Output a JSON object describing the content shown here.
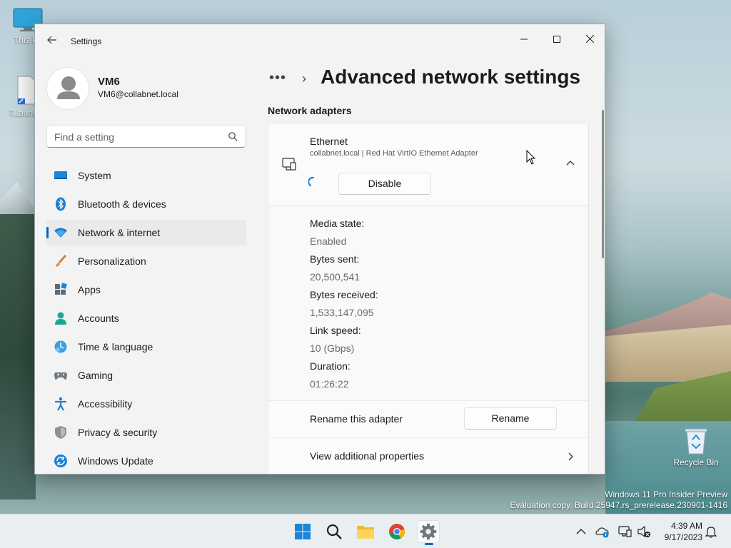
{
  "desktop": {
    "icons": [
      {
        "label": "This PC"
      },
      {
        "label": "TLauncher"
      },
      {
        "label": "Recycle Bin"
      }
    ],
    "watermark": {
      "line1": "Windows 11 Pro Insider Preview",
      "line2": "Evaluation copy. Build 25947.rs_prerelease.230901-1416"
    }
  },
  "window": {
    "title": "Settings",
    "controls": {
      "minimize": "minimize-icon",
      "maximize": "maximize-icon",
      "close": "close-icon"
    }
  },
  "profile": {
    "name": "VM6",
    "email": "VM6@collabnet.local"
  },
  "search": {
    "placeholder": "Find a setting",
    "value": ""
  },
  "sidebar": {
    "items": [
      {
        "label": "System",
        "icon": "system-icon",
        "selected": false
      },
      {
        "label": "Bluetooth & devices",
        "icon": "bluetooth-icon",
        "selected": false
      },
      {
        "label": "Network & internet",
        "icon": "network-icon",
        "selected": true
      },
      {
        "label": "Personalization",
        "icon": "brush-icon",
        "selected": false
      },
      {
        "label": "Apps",
        "icon": "apps-icon",
        "selected": false
      },
      {
        "label": "Accounts",
        "icon": "accounts-icon",
        "selected": false
      },
      {
        "label": "Time & language",
        "icon": "time-language-icon",
        "selected": false
      },
      {
        "label": "Gaming",
        "icon": "gaming-icon",
        "selected": false
      },
      {
        "label": "Accessibility",
        "icon": "accessibility-icon",
        "selected": false
      },
      {
        "label": "Privacy & security",
        "icon": "shield-icon",
        "selected": false
      },
      {
        "label": "Windows Update",
        "icon": "update-icon",
        "selected": false
      }
    ]
  },
  "content": {
    "breadcrumb_dots": "•••",
    "breadcrumb_sep": "›",
    "title": "Advanced network settings",
    "section_title": "Network adapters",
    "adapter": {
      "name": "Ethernet",
      "description": "collabnet.local | Red Hat VirtIO Ethernet Adapter",
      "disable_label": "Disable",
      "properties": [
        {
          "label": "Media state:",
          "value": "Enabled"
        },
        {
          "label": "Bytes sent:",
          "value": "20,500,541"
        },
        {
          "label": "Bytes received:",
          "value": "1,533,147,095"
        },
        {
          "label": "Link speed:",
          "value": "10 (Gbps)"
        },
        {
          "label": "Duration:",
          "value": "01:26:22"
        }
      ],
      "rename_row_label": "Rename this adapter",
      "rename_label": "Rename",
      "view_props_label": "View additional properties"
    }
  },
  "taskbar": {
    "apps": [
      "start-icon",
      "search-icon",
      "file-explorer-icon",
      "chrome-icon",
      "settings-icon"
    ],
    "clock": {
      "time": "4:39 AM",
      "date": "9/17/2023"
    }
  },
  "colors": {
    "accent": "#0067c0",
    "window_bg": "#f3f3f3",
    "card_bg": "#fbfbfb"
  }
}
